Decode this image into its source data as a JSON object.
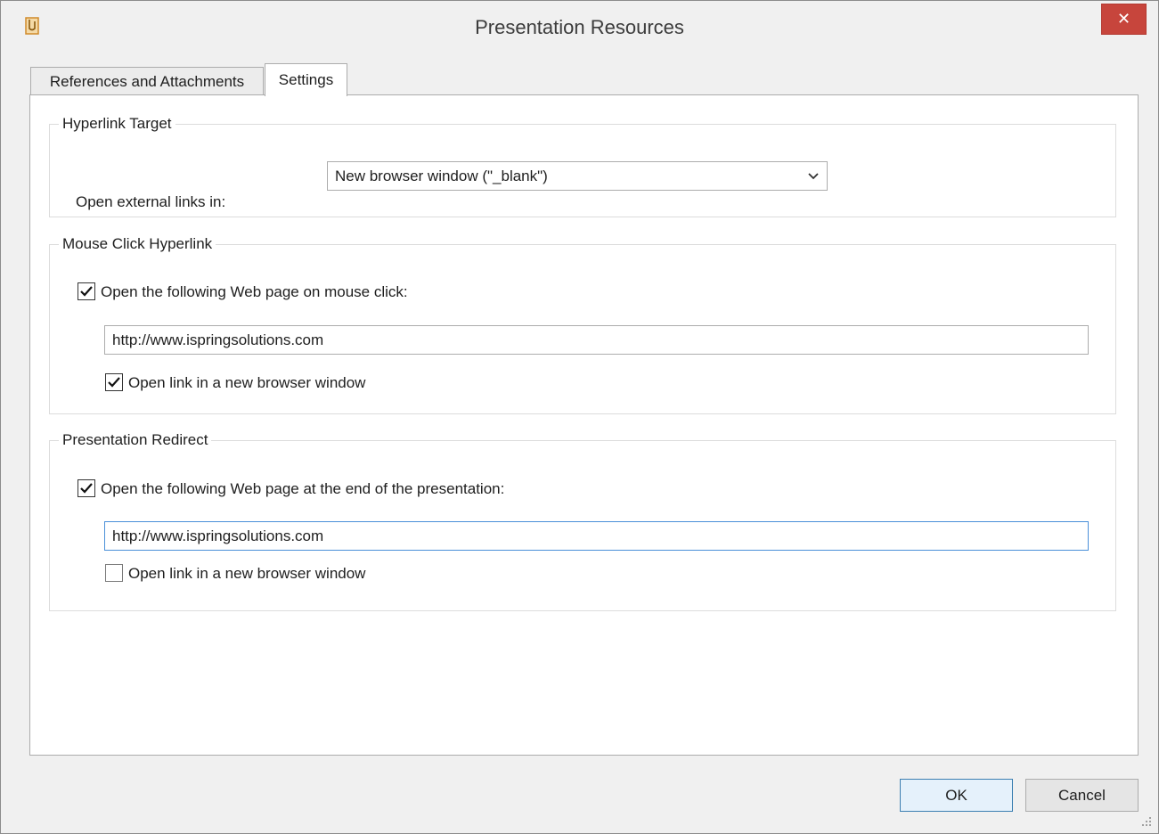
{
  "window": {
    "title": "Presentation Resources",
    "close_glyph": "✕"
  },
  "tabs": [
    {
      "label": "References and Attachments",
      "active": false
    },
    {
      "label": "Settings",
      "active": true
    }
  ],
  "hyperlink_target": {
    "title": "Hyperlink Target",
    "open_label": "Open external links in:",
    "selected": "New browser window (\"_blank\")"
  },
  "mouse_click": {
    "title": "Mouse Click Hyperlink",
    "open_page_label": "Open the following Web page on mouse click:",
    "open_page_checked": true,
    "url": "http://www.ispringsolutions.com",
    "new_window_label": "Open link in a new browser window",
    "new_window_checked": true
  },
  "redirect": {
    "title": "Presentation Redirect",
    "open_page_label": "Open the following Web page at the end of the presentation:",
    "open_page_checked": true,
    "url": "http://www.ispringsolutions.com",
    "new_window_label": "Open link in a new browser window",
    "new_window_checked": false
  },
  "buttons": {
    "ok": "OK",
    "cancel": "Cancel"
  },
  "colors": {
    "close_bg": "#c7453c",
    "focus_border": "#4a90d9",
    "default_button_border": "#3c7fb1"
  }
}
